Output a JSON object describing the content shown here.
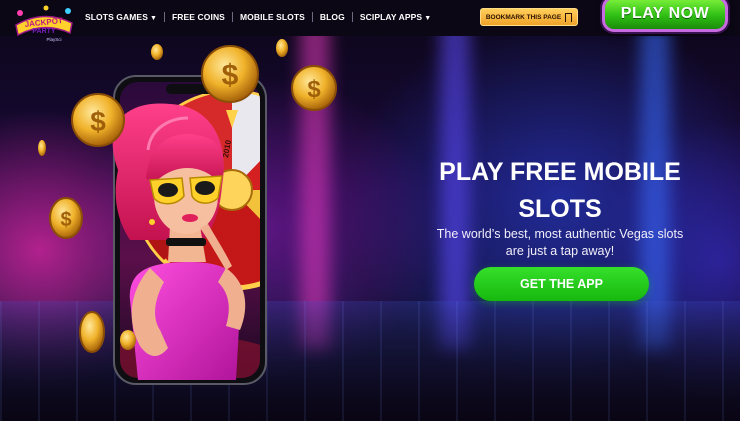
{
  "nav": {
    "logo_alt": "Jackpot Party",
    "logo_sub": "PlaySci",
    "links": [
      {
        "label": "SLOTS GAMES",
        "dropdown": true
      },
      {
        "label": "FREE COINS",
        "dropdown": false
      },
      {
        "label": "MOBILE SLOTS",
        "dropdown": false
      },
      {
        "label": "BLOG",
        "dropdown": false
      },
      {
        "label": "SCIPLAY APPS",
        "dropdown": true
      }
    ],
    "bookmark_label": "BOOKMARK THIS PAGE",
    "play_now_label": "PLAY NOW"
  },
  "hero": {
    "title_line1": "PLAY FREE MOBILE",
    "title_line2": "SLOTS",
    "subtitle_line1": "The world’s best, most authentic Vegas slots",
    "subtitle_line2": "are just a tap away!",
    "cta_label": "GET THE APP",
    "wheel_number": "2010"
  },
  "colors": {
    "accent_green": "#2fbf14",
    "bookmark_gold": "#f0a32a",
    "play_now_border": "#c86be0",
    "background_pink": "#e628aa",
    "background_blue": "#2846e6"
  }
}
